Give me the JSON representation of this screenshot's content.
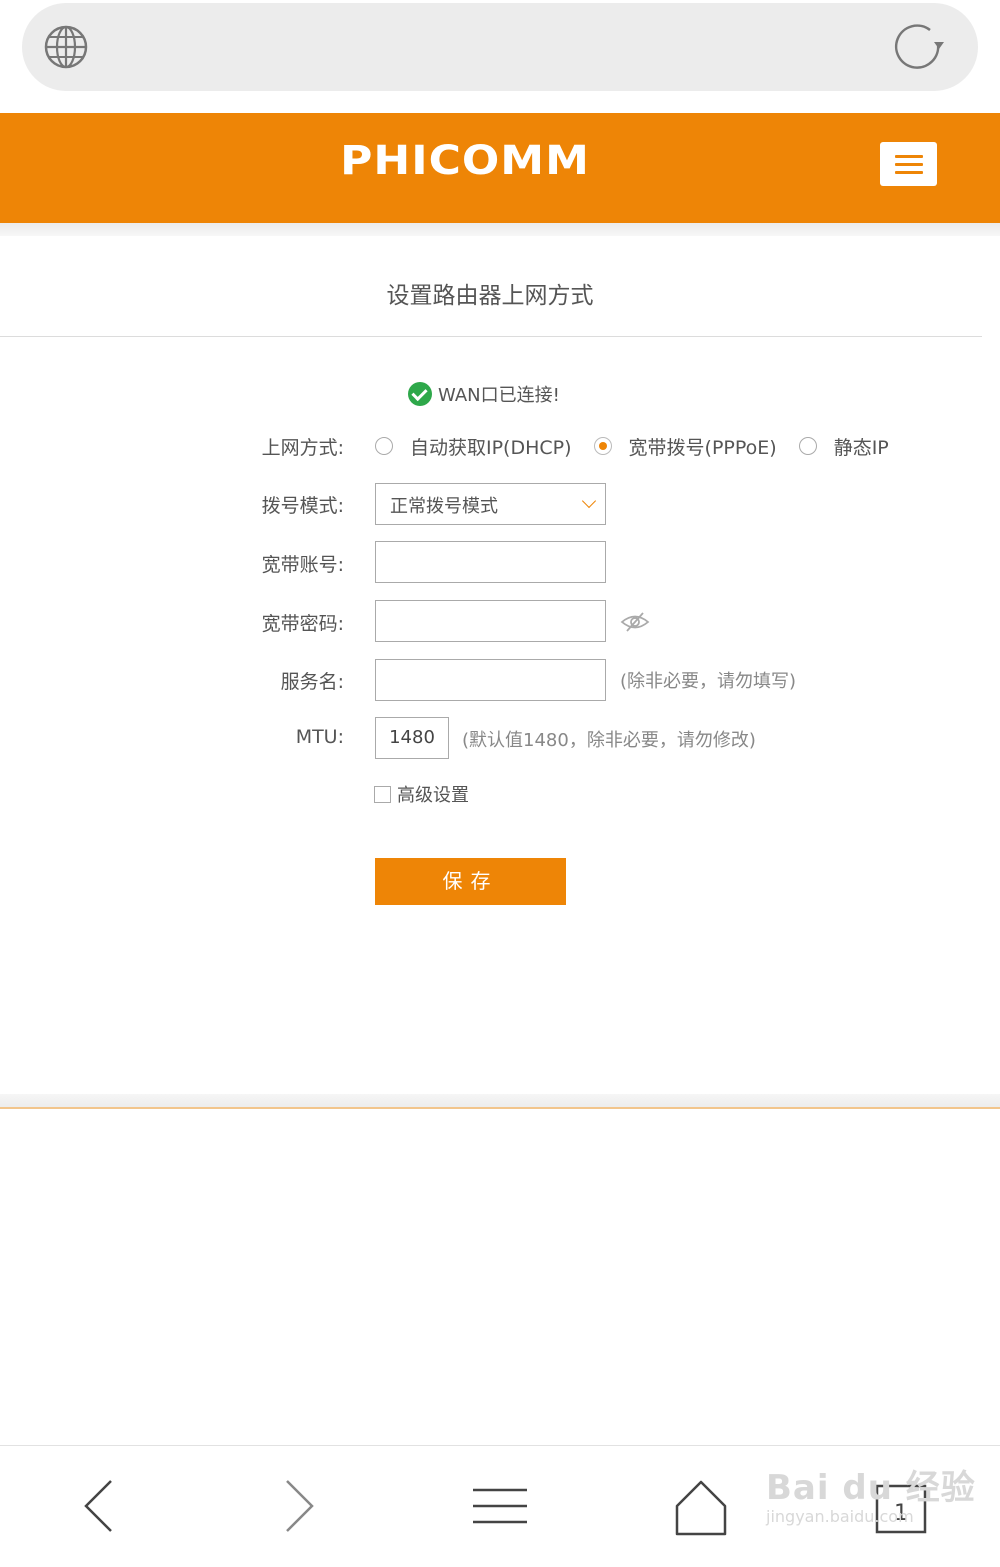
{
  "header": {
    "logo": "PHICOMM"
  },
  "page": {
    "title": "设置路由器上网方式",
    "status": "WAN口已连接!"
  },
  "form": {
    "connection_type": {
      "label": "上网方式:",
      "options": [
        "自动获取IP(DHCP)",
        "宽带拨号(PPPoE)",
        "静态IP"
      ],
      "selected": "宽带拨号(PPPoE)"
    },
    "dial_mode": {
      "label": "拨号模式:",
      "value": "正常拨号模式"
    },
    "account": {
      "label": "宽带账号:",
      "value": ""
    },
    "password": {
      "label": "宽带密码:",
      "value": ""
    },
    "service_name": {
      "label": "服务名:",
      "value": "",
      "hint": "(除非必要，请勿填写)"
    },
    "mtu": {
      "label": "MTU:",
      "value": "1480",
      "hint": "(默认值1480，除非必要，请勿修改)"
    },
    "advanced": {
      "label": "高级设置",
      "checked": false
    },
    "save_label": "保存"
  },
  "watermark": {
    "brand": "Bai du 经验",
    "url": "jingyan.baidu.com"
  },
  "colors": {
    "accent": "#ee8506",
    "success": "#2ea84a"
  }
}
